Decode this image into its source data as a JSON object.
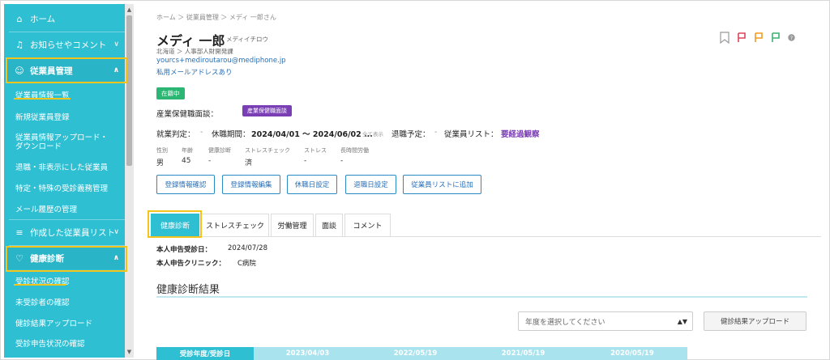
{
  "sidebar": {
    "home": "ホーム",
    "notices": "お知らせやコメント",
    "employee_mgmt": "従業員管理",
    "employee_items": [
      "従業員情報一覧",
      "新規従業員登録",
      "従業員情報アップロード・\nダウンロード",
      "退職・非表示にした従業員",
      "特定・特殊の受診義務管理",
      "メール履歴の管理"
    ],
    "created_lists": "作成した従業員リスト",
    "health_check": "健康診断",
    "health_items": [
      "受診状況の確認",
      "未受診者の確認",
      "健診結果アップロード",
      "受診申告状況の確認"
    ]
  },
  "header": {
    "breadcrumb": "ホーム ＞ 従業員管理 ＞ メディ 一郎さん",
    "name": "メディ 一郎",
    "kana": "メディイチロウ",
    "dept": "北海道 ＞ 人事部人財開発課",
    "email": "yourcs+mediroutarou@mediphone.jp",
    "private_email": "私用メールアドレスあり",
    "status": "在籍中"
  },
  "info": {
    "consult_label": "産業保健職面談：",
    "consult_badge": "産業保健職面談",
    "work_label": "就業判定：",
    "work_value": "-",
    "leave_label": "休職期間：",
    "leave_value": "2024/04/01 ～ 2024/06/02 ...",
    "leave_note": "全て表示",
    "retire_label": "退職予定：",
    "retire_value": "-",
    "list_label": "従業員リスト：",
    "list_value": "要経過観察"
  },
  "attrs": {
    "labels": [
      "性別",
      "年齢",
      "健康診断",
      "ストレスチェック",
      "ストレス",
      "長時間労働"
    ],
    "values": [
      "男",
      "45",
      "-",
      "済",
      "-",
      "-"
    ]
  },
  "buttons": [
    "登録情報確認",
    "登録情報編集",
    "休職日設定",
    "退職日設定",
    "従業員リストに追加"
  ],
  "tabs": [
    "健康診断",
    "ストレスチェック",
    "労働管理",
    "面談",
    "コメント"
  ],
  "health": {
    "self_date_label": "本人申告受診日：",
    "self_date": "2024/07/28",
    "self_clinic_label": "本人申告クリニック：",
    "self_clinic": "C病院",
    "section_title": "健康診断結果",
    "select_placeholder": "年度を選択してください",
    "upload_label": "健診結果アップロード",
    "table_headers": [
      "受診年度/受診日",
      "2023/04/03",
      "2022/05/19",
      "2021/05/19",
      "2020/05/19"
    ]
  },
  "colors": {
    "sidebar": "#2fbfd3",
    "highlight": "#f2c41c",
    "accent": "#7b3fb5",
    "status": "#2bb673"
  }
}
